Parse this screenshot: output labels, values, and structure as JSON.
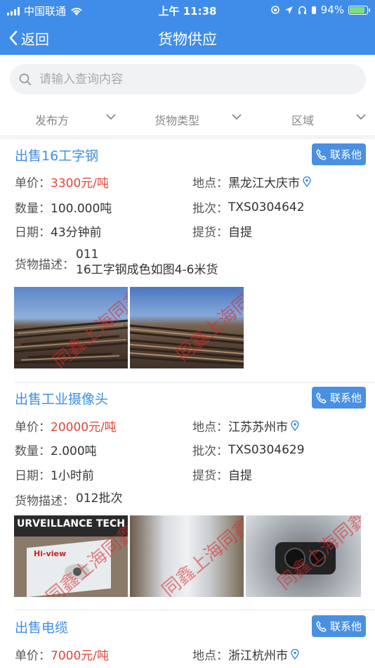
{
  "status_bar": {
    "carrier": "中国联通",
    "time": "上午 11:38",
    "battery": "94%",
    "battery_level": 0.94
  },
  "nav": {
    "back_label": "返回",
    "title": "货物供应"
  },
  "search": {
    "placeholder": "请输入查询内容"
  },
  "filters": [
    {
      "label": "发布方"
    },
    {
      "label": "货物类型"
    },
    {
      "label": "区域"
    }
  ],
  "labels": {
    "price": "单价：",
    "location": "地点：",
    "quantity": "数量：",
    "batch": "批次：",
    "date": "日期：",
    "pickup": "提货：",
    "description": "货物描述：",
    "contact": "联系他"
  },
  "listings": [
    {
      "title": "出售16工字钢",
      "price": "3300元/吨",
      "location": "黑龙江大庆市",
      "quantity": "100.000吨",
      "batch": "TXS0304642",
      "date": "43分钟前",
      "pickup": "自提",
      "description_line1": "011",
      "description_line2": "16工字钢成色如图4-6米货",
      "watermark": "同鑫上海同鑫"
    },
    {
      "title": "出售工业摄像头",
      "price": "20000元/吨",
      "location": "江苏苏州市",
      "quantity": "2.000吨",
      "batch": "TXS0304629",
      "date": "1小时前",
      "pickup": "自提",
      "description_line1": "012批次",
      "photo_text_1": "URVEILLANCE TECH",
      "photo_text_2": "Hi-view",
      "watermark": "同鑫上海同鑫"
    },
    {
      "title": "出售电缆",
      "price": "7000元/吨",
      "location": "浙江杭州市"
    }
  ]
}
